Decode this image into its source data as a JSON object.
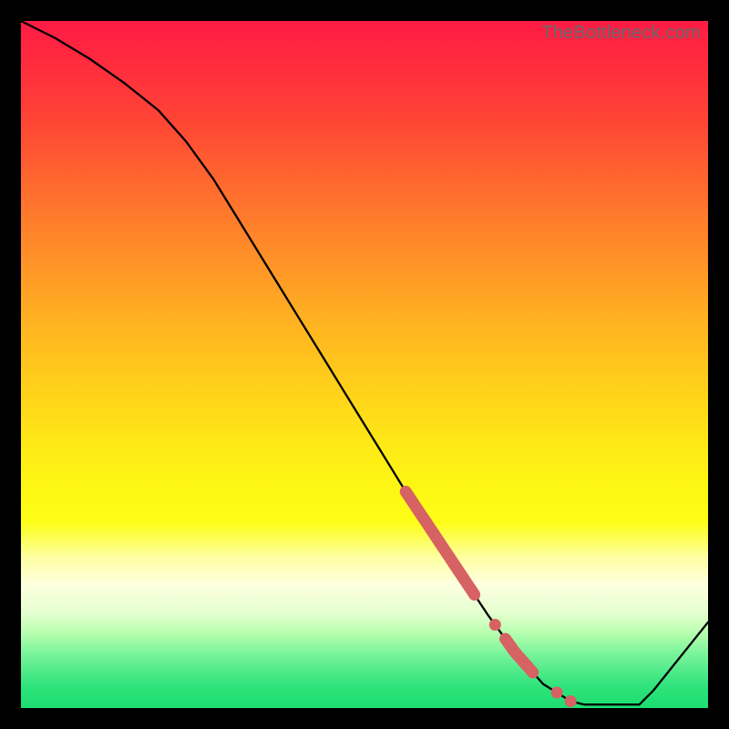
{
  "watermark": "TheBottleneck.com",
  "colors": {
    "frame": "#000000",
    "line": "#000000",
    "markers": "#d66263"
  },
  "chart_data": {
    "type": "line",
    "title": "",
    "xlabel": "",
    "ylabel": "",
    "xlim": [
      0,
      100
    ],
    "ylim": [
      0,
      100
    ],
    "grid": false,
    "legend": false,
    "series": [
      {
        "name": "curve",
        "x": [
          0,
          5,
          10,
          15,
          20,
          24,
          28,
          32,
          36,
          40,
          44,
          48,
          52,
          56,
          60,
          64,
          68,
          72,
          76,
          80,
          82,
          84,
          86,
          88,
          90,
          92,
          100
        ],
        "y": [
          100,
          97.5,
          94.5,
          91,
          87,
          82.5,
          77,
          70.5,
          64,
          57.5,
          51,
          44.5,
          38,
          31.5,
          25.5,
          19.5,
          13.5,
          8,
          3.5,
          1,
          0.5,
          0.5,
          0.5,
          0.5,
          0.5,
          2.5,
          12.5
        ]
      }
    ],
    "markers": [
      {
        "type": "thick-segment",
        "x_start": 56,
        "x_end": 66,
        "note": "heavy line overlay on curve"
      },
      {
        "type": "dot",
        "x": 69
      },
      {
        "type": "thick-segment",
        "x_start": 70.5,
        "x_end": 74.5
      },
      {
        "type": "dot",
        "x": 78
      },
      {
        "type": "dot",
        "x": 80
      }
    ],
    "background_gradient": "red-to-green vertical"
  }
}
